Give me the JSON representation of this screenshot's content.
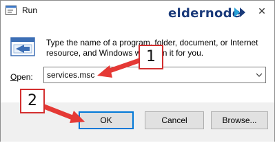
{
  "window": {
    "title": "Run",
    "close_glyph": "✕"
  },
  "watermark": {
    "brand": "eldernode"
  },
  "dialog": {
    "description": "Type the name of a program, folder, document, or Internet resource, and Windows will open it for you.",
    "open_label_prefix": "",
    "open_label_accel": "O",
    "open_label_rest": "pen:",
    "input_value": "services.msc"
  },
  "buttons": {
    "ok": "OK",
    "cancel": "Cancel",
    "browse": "Browse..."
  },
  "annotations": {
    "step1": "1",
    "step2": "2",
    "color": "#e53935"
  },
  "icons": {
    "app": "run-app-icon",
    "run": "run-program-icon",
    "close": "close-icon",
    "dropdown": "chevron-down-icon"
  }
}
